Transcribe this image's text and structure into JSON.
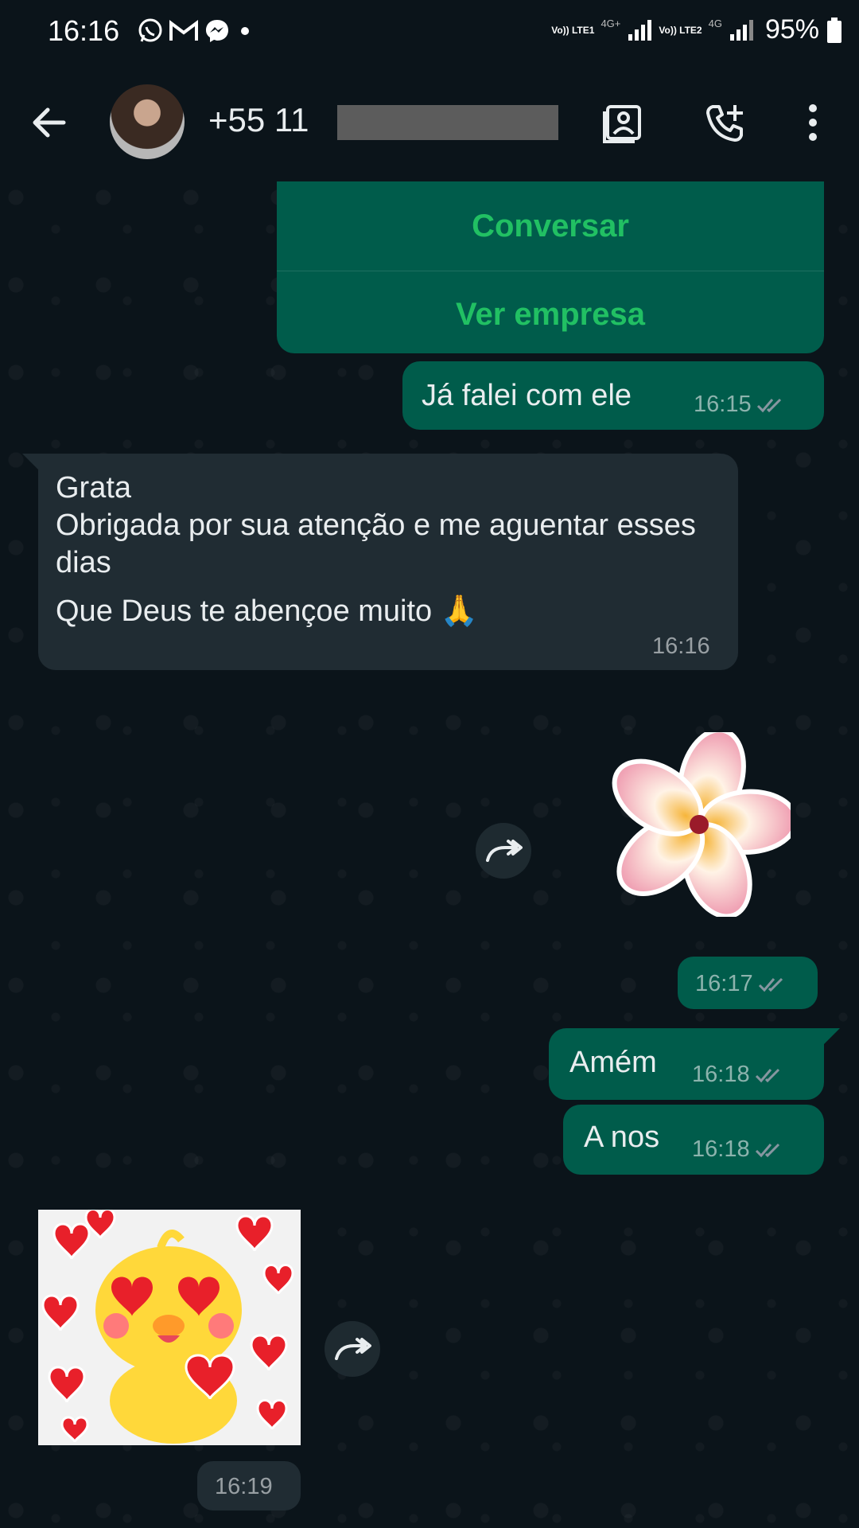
{
  "status_bar": {
    "time": "16:16",
    "sim1": "Vo)) LTE1",
    "sim1_type": "4G+",
    "sim2": "Vo)) LTE2",
    "sim2_type": "4G",
    "battery": "95%",
    "notification_icons": [
      "whatsapp-icon",
      "gmail-icon",
      "messenger-icon",
      "dot-icon"
    ]
  },
  "header": {
    "contact": "+55 11",
    "icons": [
      "back-arrow-icon",
      "contact-card-icon",
      "add-call-icon",
      "more-vert-icon"
    ]
  },
  "business_card": {
    "buttons": [
      "Conversar",
      "Ver empresa"
    ]
  },
  "messages": [
    {
      "direction": "out",
      "text": "Já falei com ele",
      "time": "16:15",
      "status": "read"
    },
    {
      "direction": "in",
      "lines": [
        "Grata",
        "Obrigada por sua atenção e me aguentar esses dias",
        "Que Deus te abençoe muito 🙏"
      ],
      "time": "16:16"
    },
    {
      "direction": "out",
      "type": "sticker",
      "sticker": "flower",
      "time": "16:17",
      "status": "read"
    },
    {
      "direction": "out",
      "text": "Amém",
      "time": "16:18",
      "status": "read"
    },
    {
      "direction": "out",
      "text": "A nos",
      "time": "16:18",
      "status": "read"
    },
    {
      "direction": "in",
      "type": "sticker",
      "sticker": "duck-hearts",
      "time": "16:19"
    }
  ],
  "colors": {
    "background": "#0b141a",
    "outgoing_bubble": "#005c4b",
    "incoming_bubble": "#202c33",
    "button_text": "#21c063",
    "tick": "#8696a0"
  }
}
